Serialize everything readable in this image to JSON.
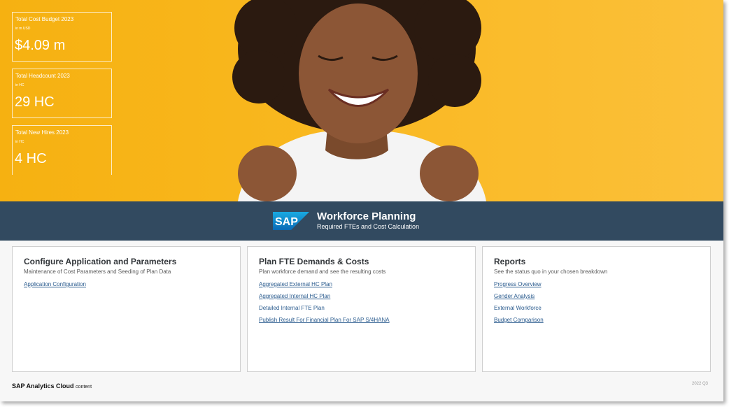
{
  "kpis": [
    {
      "title": "Total Cost Budget 2023",
      "unit": "in m USD",
      "value": "$4.09 m"
    },
    {
      "title": "Total Headcount 2023",
      "unit": "in HC",
      "value": "29 HC"
    },
    {
      "title": "Total New Hires 2023",
      "unit": "in HC",
      "value": "4 HC"
    }
  ],
  "banner": {
    "logo_text": "SAP",
    "title": "Workforce Planning",
    "subtitle": "Required FTEs and Cost Calculation"
  },
  "cards": [
    {
      "title": "Configure Application and Parameters",
      "subtitle": "Maintenance of Cost Parameters and Seeding of Plan Data",
      "links": [
        "Application Configuration"
      ]
    },
    {
      "title": "Plan FTE Demands & Costs",
      "subtitle": "Plan workforce demand and see the resulting costs",
      "links": [
        "Aggregated External HC Plan",
        "Aggregated Internal HC Plan",
        "Detailed Internal FTE Plan",
        "Publish Result For Financial Plan For SAP S/4HANA"
      ]
    },
    {
      "title": "Reports",
      "subtitle": "See the status quo in your chosen breakdown",
      "links": [
        "Progress Overview",
        "Gender Analysis",
        "External Workforce",
        "Budget Comparison"
      ]
    }
  ],
  "footer": {
    "brand": "SAP Analytics Cloud",
    "brand_suffix": "content",
    "version": "2022 Q3"
  },
  "colors": {
    "hero_yellow": "#f9b820",
    "banner_navy": "#324a60",
    "link_blue": "#2a5b8e"
  }
}
